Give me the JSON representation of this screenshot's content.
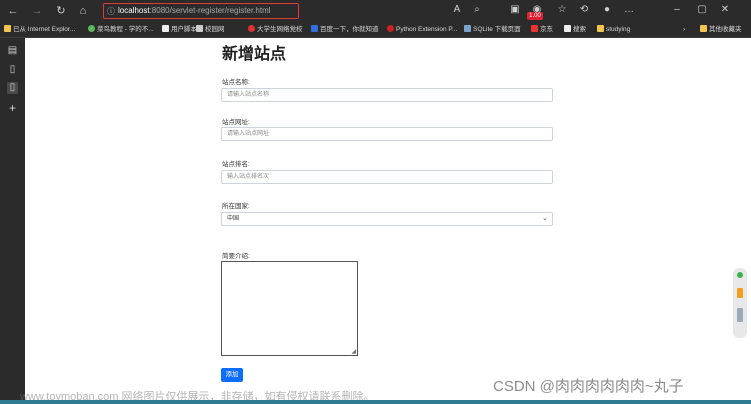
{
  "browser": {
    "address": {
      "host": "localhost",
      "path": ":8080/servlet-register/register.html"
    },
    "bookmarks": [
      "已从 Internet Explor...",
      "菜鸟教程 - 学的不...",
      "用户脚本",
      "校园网",
      "大学生网络党校",
      "百度一下，你就知道",
      "Python Extension P...",
      "SQLite 下载页面",
      "京东",
      "搜索",
      "studying",
      "其他收藏夹"
    ],
    "badge": "1.00"
  },
  "form": {
    "title": "新增站点",
    "fields": [
      {
        "label": "站点名称:",
        "placeholder": "请输入站点名称"
      },
      {
        "label": "站点网址:",
        "placeholder": "请输入站点网址"
      },
      {
        "label": "站点排名:",
        "placeholder": "输入站点排名次"
      }
    ],
    "country": {
      "label": "所在国家:",
      "value": "中国"
    },
    "intro": {
      "label": "简要介绍:"
    },
    "submit_label": "添加"
  },
  "watermark": {
    "left": "www.toymoban.com 网络图片仅供展示，非存储，如有侵权请联系删除。",
    "right": "CSDN @肉肉肉肉肉肉~丸子"
  }
}
